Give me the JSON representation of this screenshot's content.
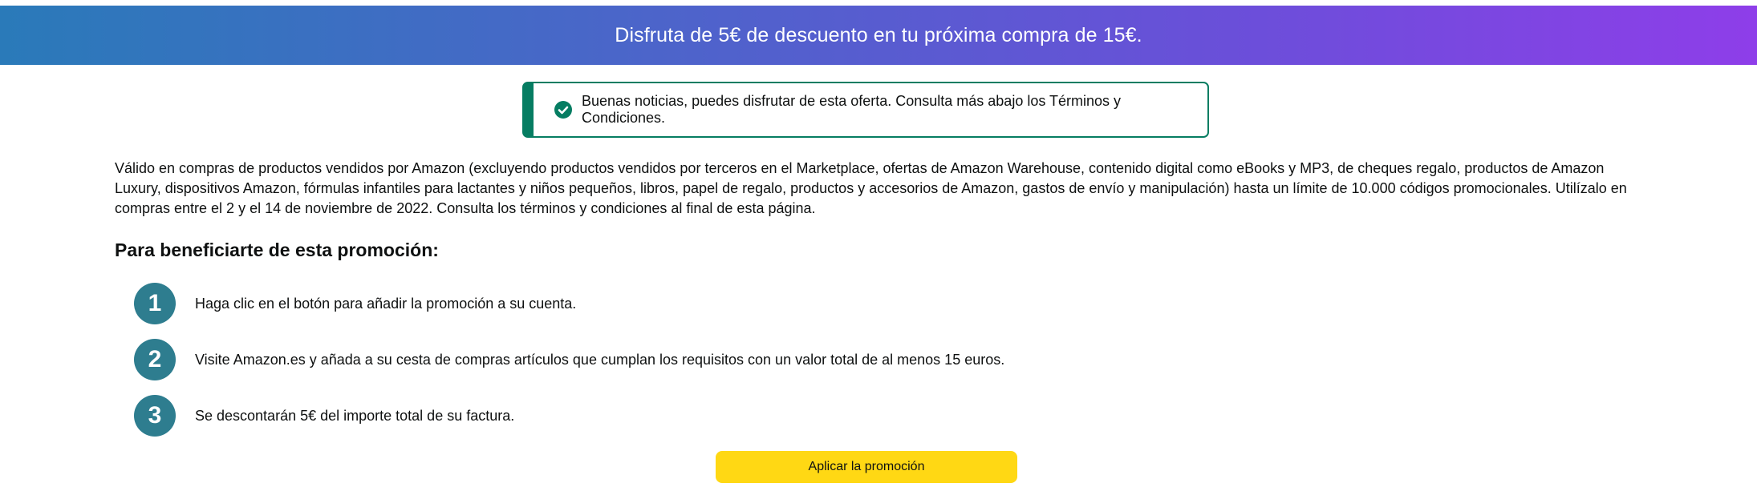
{
  "banner": {
    "text": "Disfruta de 5€ de descuento en tu próxima compra de 15€."
  },
  "notice": {
    "icon": "check-circle-icon",
    "text": "Buenas noticias, puedes disfrutar de esta oferta. Consulta más abajo los Términos y Condiciones."
  },
  "terms": {
    "text": "Válido en compras de productos vendidos por Amazon (excluyendo productos vendidos por terceros en el Marketplace, ofertas de Amazon Warehouse, contenido digital como eBooks y MP3, de cheques regalo, productos de Amazon Luxury, dispositivos Amazon, fórmulas infantiles para lactantes y niños pequeños, libros, papel de regalo, productos y accesorios de Amazon, gastos de envío y manipulación) hasta un límite de 10.000 códigos promocionales. Utilízalo en compras entre el 2 y el 14 de noviembre de 2022. Consulta los términos y condiciones al final de esta página."
  },
  "how": {
    "title": "Para beneficiarte de esta promoción:",
    "steps": [
      {
        "number": "1",
        "text": "Haga clic en el botón para añadir la promoción a su cuenta."
      },
      {
        "number": "2",
        "text": "Visite Amazon.es y añada a su cesta de compras artículos que cumplan los requisitos con un valor total de al menos 15 euros."
      },
      {
        "number": "3",
        "text": "Se descontarán 5€ del importe total de su factura."
      }
    ]
  },
  "apply_button": {
    "label": "Aplicar la promoción"
  },
  "colors": {
    "banner_gradient_start": "#2a7ab9",
    "banner_gradient_end": "#8e3ee9",
    "success_green": "#067d62",
    "step_circle": "#2e7d8f",
    "button_yellow": "#ffd814"
  }
}
